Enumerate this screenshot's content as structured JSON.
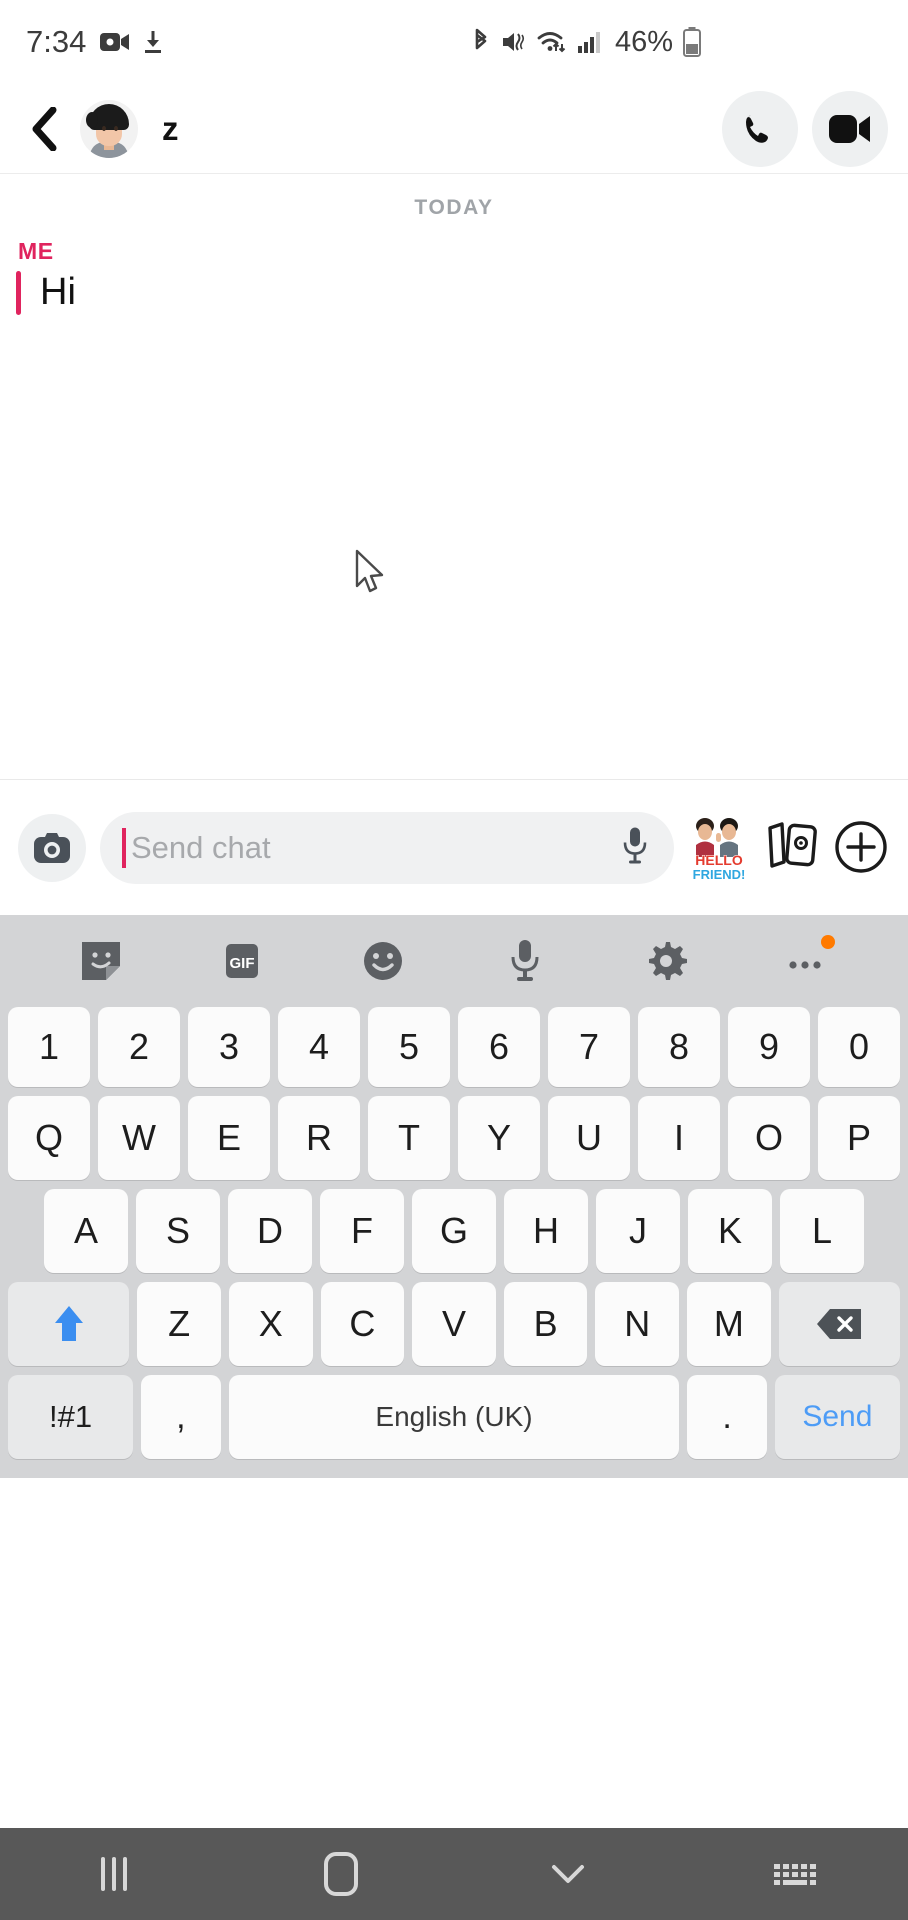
{
  "status_bar": {
    "time": "7:34",
    "battery_percent": "46%",
    "icons": [
      "video-recording-icon",
      "download-icon",
      "bluetooth-icon",
      "mute-vibrate-icon",
      "wifi-icon",
      "cellular-signal-icon",
      "battery-icon"
    ]
  },
  "chat_header": {
    "back_label": "‹",
    "contact_name": "z",
    "avatar_name": "bitmoji-avatar",
    "call_icon": "phone-icon",
    "video_icon": "video-camera-icon"
  },
  "conversation": {
    "date_divider": "TODAY",
    "messages": [
      {
        "sender": "ME",
        "text": "Hi",
        "accent_color": "#e0245e"
      }
    ]
  },
  "input_bar": {
    "camera_icon": "camera-icon",
    "placeholder": "Send chat",
    "value": "",
    "mic_icon": "microphone-icon",
    "sticker_label": "HELLO FRIEND!",
    "cards_icon": "sticker-cards-icon",
    "plus_icon": "plus-circle-icon"
  },
  "keyboard": {
    "toolbar": [
      {
        "name": "sticker-icon",
        "label": ""
      },
      {
        "name": "gif-icon",
        "label": "GIF"
      },
      {
        "name": "emoji-icon",
        "label": ""
      },
      {
        "name": "voice-input-icon",
        "label": ""
      },
      {
        "name": "settings-gear-icon",
        "label": ""
      },
      {
        "name": "more-options-icon",
        "label": ""
      }
    ],
    "rows": {
      "numbers": [
        "1",
        "2",
        "3",
        "4",
        "5",
        "6",
        "7",
        "8",
        "9",
        "0"
      ],
      "top": [
        "Q",
        "W",
        "E",
        "R",
        "T",
        "Y",
        "U",
        "I",
        "O",
        "P"
      ],
      "home": [
        "A",
        "S",
        "D",
        "F",
        "G",
        "H",
        "J",
        "K",
        "L"
      ],
      "bottom": [
        "Z",
        "X",
        "C",
        "V",
        "B",
        "N",
        "M"
      ]
    },
    "shift_label": "",
    "backspace_label": "",
    "symbols_label": "!#1",
    "comma_label": ",",
    "space_label": "English (UK)",
    "period_label": ".",
    "send_label": "Send",
    "send_color": "#4d9cf6",
    "background": "#d3d4d6"
  },
  "nav_bar": {
    "recents_label": "recents-button",
    "home_label": "home-button",
    "dismiss_label": "dismiss-keyboard-button",
    "switch_label": "switch-keyboard-button"
  }
}
